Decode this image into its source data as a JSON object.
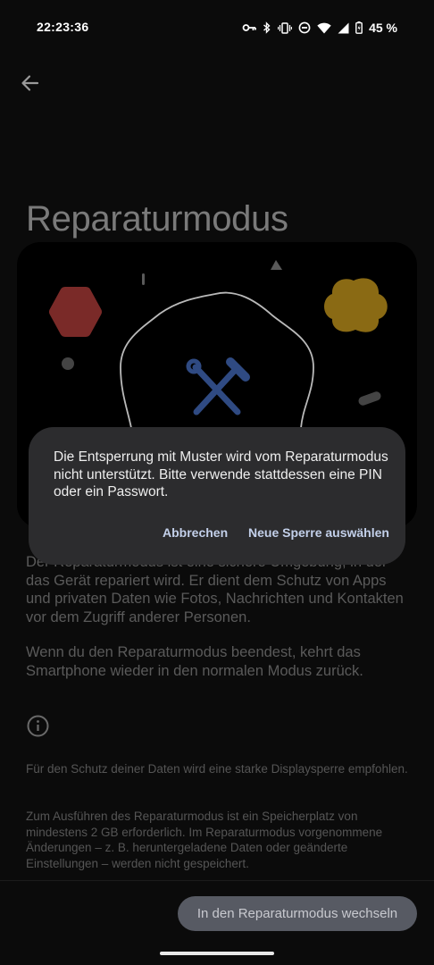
{
  "status_bar": {
    "time": "22:23:36",
    "battery": "45 %",
    "icons": [
      "vpn-key-icon",
      "bluetooth-icon",
      "vibrate-icon",
      "do-not-disturb-icon",
      "wifi-icon",
      "cell-signal-icon",
      "battery-icon"
    ]
  },
  "header": {
    "title": "Reparaturmodus"
  },
  "body": {
    "paragraph_1": "Der Reparaturmodus ist eine sichere Umgebung, in der das Gerät repariert wird. Er dient dem Schutz von Apps und privaten Daten wie Fotos, Nachrichten und Kontakten vor dem Zugriff anderer Personen.",
    "paragraph_2": "Wenn du den Reparaturmodus beendest, kehrt das Smartphone wieder in den normalen Modus zurück.",
    "info_1": "Für den Schutz deiner Daten wird eine starke Displaysperre empfohlen.",
    "info_2": "Zum Ausführen des Reparaturmodus ist ein Speicherplatz von mindestens 2 GB erforderlich. Im Reparaturmodus vorgenommene Änderungen – z. B. heruntergeladene Daten oder geänderte Einstellungen – werden nicht gespeichert."
  },
  "footer": {
    "primary_button": "In den Reparaturmodus wechseln"
  },
  "dialog": {
    "message": "Die Entsperrung mit Muster wird vom Reparaturmodus nicht unterstützt. Bitte verwende stattdessen eine PIN oder ein Passwort.",
    "cancel_label": "Abbrechen",
    "confirm_label": "Neue Sperre auswählen"
  },
  "colors": {
    "background": "#0b0b0b",
    "dialog": "#2c2c2e",
    "dialog_button_text": "#c3d0ea",
    "shape_red": "#7a2a28",
    "shape_yellow": "#8a6a14",
    "tool_icon": "#2f4a82"
  }
}
